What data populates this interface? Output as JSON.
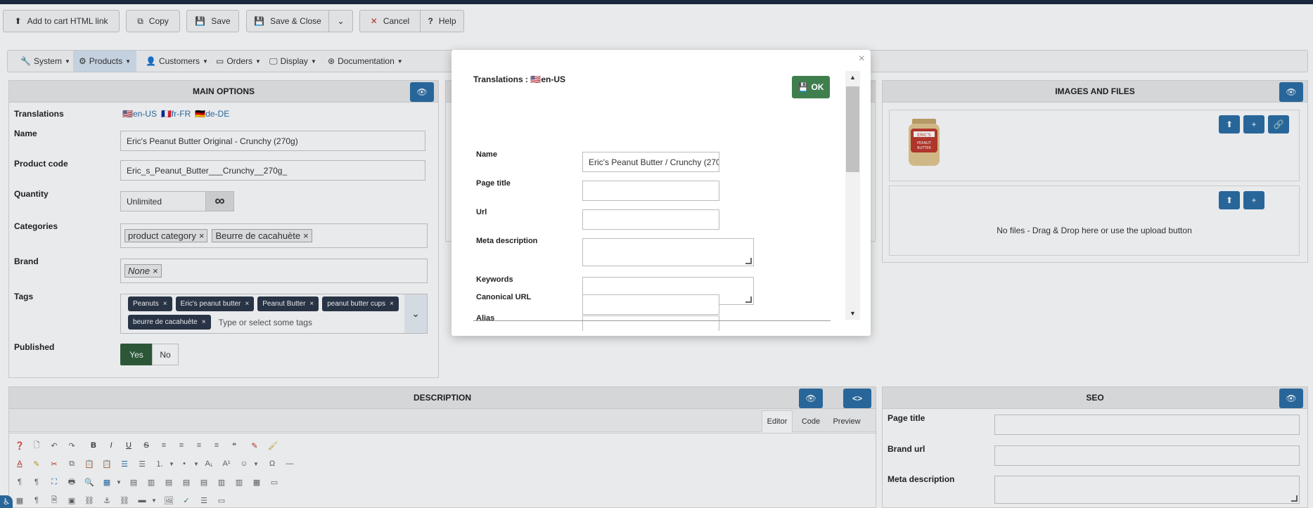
{
  "toolbar": {
    "add_to_cart": "Add to cart HTML link",
    "copy": "Copy",
    "save": "Save",
    "save_close": "Save & Close",
    "cancel": "Cancel",
    "help": "Help"
  },
  "menu": [
    "System",
    "Products",
    "Customers",
    "Orders",
    "Display",
    "Documentation"
  ],
  "main_options": {
    "title": "MAIN OPTIONS",
    "translations_label": "Translations",
    "langs": [
      "en-US",
      "fr-FR",
      "de-DE"
    ],
    "name_label": "Name",
    "name_value": "Eric's Peanut Butter Original - Crunchy (270g)",
    "code_label": "Product code",
    "code_value": "Eric_s_Peanut_Butter___Crunchy__270g_",
    "quantity_label": "Quantity",
    "quantity_value": "Unlimited",
    "categories_label": "Categories",
    "categories": [
      "product category",
      "Beurre de cacahuète"
    ],
    "brand_label": "Brand",
    "brand_value": "None",
    "tags_label": "Tags",
    "tags": [
      "Peanuts",
      "Eric's peanut butter",
      "Peanut Butter",
      "peanut butter cups",
      "beurre de cacahuète"
    ],
    "tags_placeholder": "Type or select some tags",
    "published_label": "Published",
    "yes": "Yes",
    "no": "No"
  },
  "images": {
    "title": "IMAGES AND FILES",
    "no_files": "No files - Drag & Drop here or use the upload button"
  },
  "description": {
    "title": "DESCRIPTION",
    "tabs": [
      "Editor",
      "Code",
      "Preview"
    ]
  },
  "seo": {
    "title": "SEO",
    "page_title_label": "Page title",
    "brand_url_label": "Brand url",
    "meta_desc_label": "Meta description"
  },
  "modal": {
    "title": "Translations : ",
    "lang": "en-US",
    "ok": "OK",
    "close": "×",
    "name_label": "Name",
    "name_value": "Eric's Peanut Butter / Crunchy (270",
    "page_title_label": "Page title",
    "url_label": "Url",
    "meta_label": "Meta description",
    "keywords_label": "Keywords",
    "alias_label": "Alias",
    "canonical_label": "Canonical URL"
  },
  "colors": {
    "primary": "#2b6ea5",
    "success": "#3f7f4e",
    "published": "#2f5e3a",
    "tag_bg": "#2b3648"
  }
}
